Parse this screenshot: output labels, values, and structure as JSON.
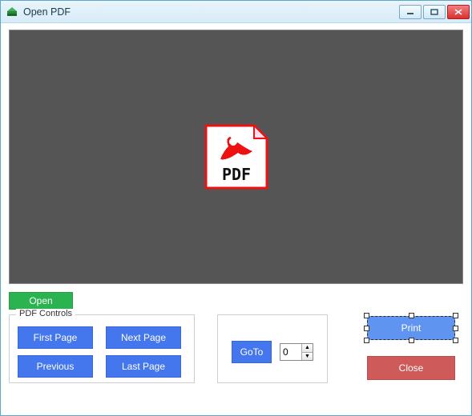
{
  "window": {
    "title": "Open PDF"
  },
  "buttons": {
    "open": "Open",
    "first_page": "First Page",
    "next_page": "Next Page",
    "previous": "Previous",
    "last_page": "Last Page",
    "goto": "GoTo",
    "print": "Print",
    "close": "Close"
  },
  "group": {
    "controls_label": "PDF Controls"
  },
  "goto": {
    "value": "0"
  },
  "icons": {
    "pdf_label": "PDF"
  }
}
